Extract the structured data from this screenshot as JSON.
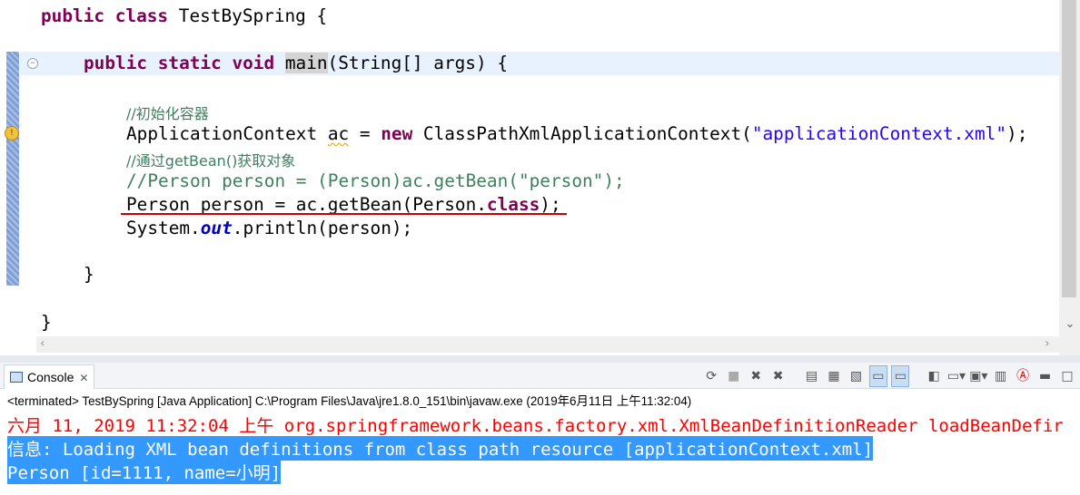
{
  "editor": {
    "lines": {
      "class_decl": {
        "kw": "public class",
        "rest": " TestBySpring {"
      },
      "main_decl": {
        "kw": "public static void",
        "method": "main",
        "rest": "(String[] args) {"
      },
      "comment1": "//初始化容器",
      "appctx": {
        "type": "ApplicationContext",
        "var": "ac",
        "op": " = ",
        "kw": "new",
        "ctor": " ClassPathXmlApplicationContext(",
        "str": "\"applicationContext.xml\"",
        "end": ");"
      },
      "comment2": "//通过getBean()获取对象",
      "comment3": "//Person person = (Person)ac.getBean(\"person\");",
      "getbean": {
        "pre": "Person person = ac.getBean(Person.",
        "kw": "class",
        "end": ");"
      },
      "println": {
        "pre": "System.",
        "field": "out",
        "end": ".println(person);"
      },
      "close_method": "}",
      "close_class": "}"
    }
  },
  "console": {
    "tab_label": "Console",
    "tab_close": "✕",
    "terminated": "<terminated> TestBySpring [Java Application] C:\\Program Files\\Java\\jre1.8.0_151\\bin\\javaw.exe (2019年6月11日 上午11:32:04)",
    "output": [
      "六月 11, 2019 11:32:04 上午 org.springframework.beans.factory.xml.XmlBeanDefinitionReader loadBeanDefir",
      "信息: Loading XML bean definitions from class path resource [applicationContext.xml]",
      "Person [id=1111, name=小明]"
    ],
    "toolbar_icons": [
      "remove-launch-icon",
      "terminate-icon",
      "remove-all-icon",
      "remove-terminated-icon",
      "scroll-lock-icon",
      "word-wrap-icon",
      "show-on-stdout-icon",
      "show-on-stderr-icon",
      "pin-console-icon",
      "display-selected-console-icon",
      "open-console-icon",
      "minimize-icon",
      "maximize-icon"
    ]
  },
  "colors": {
    "keyword": "#7f0055",
    "comment": "#3f7f5f",
    "string": "#2a00ff",
    "field": "#0000c0",
    "error": "#ff0000",
    "selection": "#3399ff"
  }
}
